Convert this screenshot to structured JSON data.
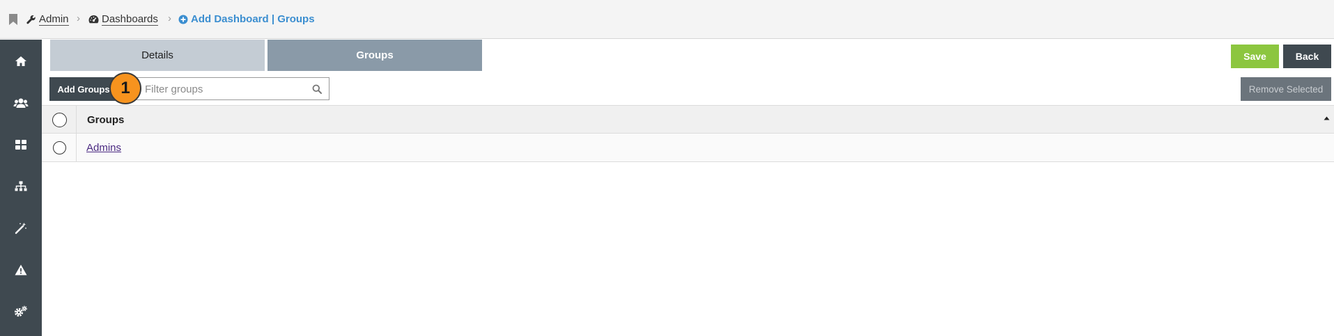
{
  "breadcrumb": {
    "items": [
      {
        "label": "Admin",
        "icon": "wrench-icon"
      },
      {
        "label": "Dashboards",
        "icon": "dashboard-icon"
      }
    ],
    "current": {
      "label": "Add Dashboard | Groups",
      "icon": "plus-circle-icon"
    },
    "active_color": "#3b8ed0"
  },
  "sidebar": {
    "items": [
      {
        "icon": "home-icon"
      },
      {
        "icon": "users-icon"
      },
      {
        "icon": "dashboards-icon"
      },
      {
        "icon": "hierarchy-icon"
      },
      {
        "icon": "magic-wand-icon"
      },
      {
        "icon": "warning-icon"
      },
      {
        "icon": "settings-icon"
      }
    ],
    "background": "#3f4950"
  },
  "tabs": [
    {
      "label": "Details",
      "active": false
    },
    {
      "label": "Groups",
      "active": true
    }
  ],
  "toolbar": {
    "save_label": "Save",
    "back_label": "Back",
    "add_groups_label": "Add Groups",
    "remove_selected_label": "Remove Selected",
    "filter_placeholder": "Filter groups",
    "save_color": "#8cc63f"
  },
  "annotation": {
    "step": "1",
    "color": "#f7931e"
  },
  "table": {
    "columns": [
      "Groups"
    ],
    "rows": [
      {
        "name": "Admins"
      }
    ]
  }
}
